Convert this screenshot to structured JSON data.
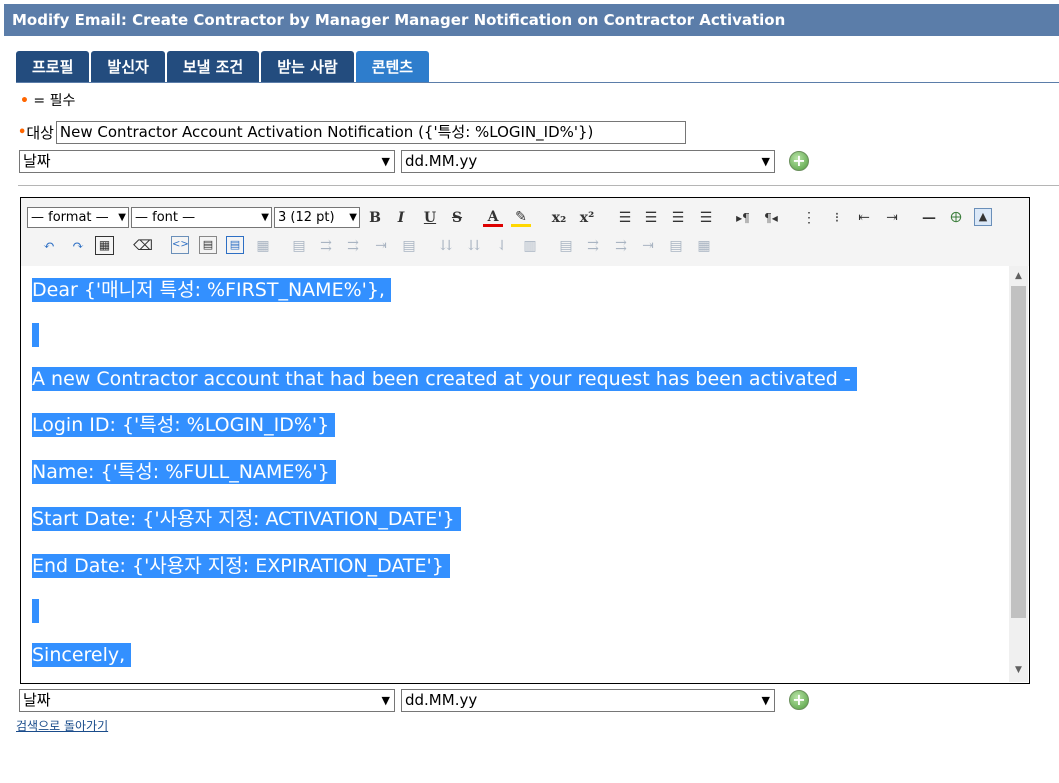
{
  "title": "Modify Email: Create Contractor by Manager Manager Notification on Contractor Activation",
  "tabs": [
    {
      "label": "프로필"
    },
    {
      "label": "발신자"
    },
    {
      "label": "보낼 조건"
    },
    {
      "label": "받는 사람"
    },
    {
      "label": "콘텐츠",
      "active": true
    }
  ],
  "required_note": "= 필수",
  "subject": {
    "label": "대상",
    "value": "New Contractor Account Activation Notification ({'특성: %LOGIN_ID%'})"
  },
  "date_top": {
    "field": "날짜",
    "format": "dd.MM.yy"
  },
  "toolbar": {
    "format_select": "— format —",
    "font_select": "— font —",
    "size_select": "3 (12 pt)"
  },
  "editor": {
    "lines": [
      "Dear {'매니저 특성: %FIRST_NAME%'},",
      "",
      "A new Contractor account that had been created at your request has been activated -",
      "Login ID: {'특성: %LOGIN_ID%'}",
      "Name: {'특성: %FULL_NAME%'}",
      "Start Date: {'사용자 지정: ACTIVATION_DATE'}",
      "End Date: {'사용자 지정: EXPIRATION_DATE'}",
      "",
      "Sincerely,"
    ]
  },
  "date_bottom": {
    "field": "날짜",
    "format": "dd.MM.yy"
  },
  "back_link": "검색으로 돌아가기",
  "colors": {
    "title_bar": "#5b7da9",
    "tab": "#234c7e",
    "tab_active": "#2e7dcc",
    "selection": "#3390ff",
    "required_bullet": "#ff6600"
  }
}
